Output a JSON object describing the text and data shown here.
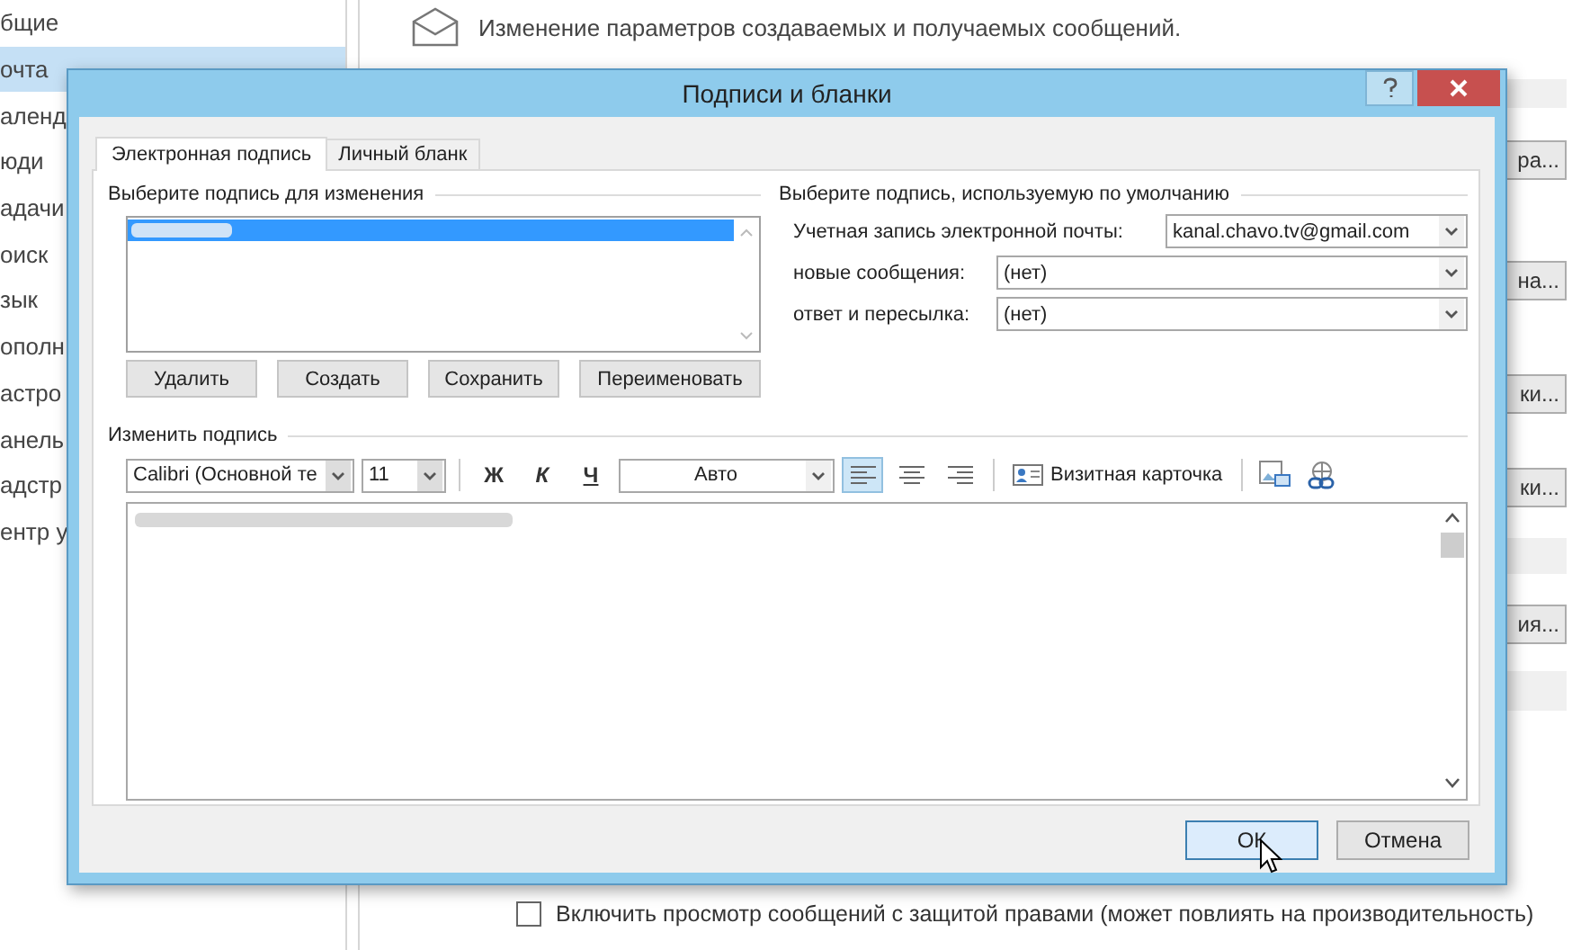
{
  "sidebar": {
    "items": [
      {
        "label": "бщие",
        "selected": false
      },
      {
        "label": "очта",
        "selected": true
      },
      {
        "label": "аленд",
        "selected": false
      },
      {
        "label": "юди",
        "selected": false
      },
      {
        "label": "адачи",
        "selected": false
      },
      {
        "label": "оиск",
        "selected": false
      },
      {
        "label": "зык",
        "selected": false
      },
      {
        "label": "ополн",
        "selected": false
      },
      {
        "label": "астро",
        "selected": false
      },
      {
        "label": "анель",
        "selected": false
      },
      {
        "label": "адстр",
        "selected": false
      },
      {
        "label": "ентр у",
        "selected": false
      }
    ]
  },
  "content": {
    "header": "Изменение параметров создаваемых и получаемых сообщений.",
    "side_items": [
      {
        "kind": "band"
      },
      {
        "kind": "button",
        "label": "ра..."
      },
      {
        "kind": "button",
        "label": "на..."
      },
      {
        "kind": "button",
        "label": "ки..."
      },
      {
        "kind": "button",
        "label": "ки..."
      },
      {
        "kind": "band"
      },
      {
        "kind": "button",
        "label": "ия..."
      },
      {
        "kind": "band"
      }
    ],
    "option": {
      "label": "Включить просмотр сообщений с защитой правами (может повлиять на производительность)",
      "checked": false
    }
  },
  "dialog": {
    "title": "Подписи и бланки",
    "tabs": [
      {
        "label": "Электронная подпись",
        "selected": true
      },
      {
        "label": "Личный бланк",
        "selected": false
      }
    ],
    "select_group": {
      "title": "Выберите подпись для изменения",
      "signatures": [
        {
          "kind": "redacted",
          "selected": true
        }
      ],
      "buttons": [
        "Удалить",
        "Создать",
        "Сохранить",
        "Переименовать"
      ]
    },
    "default_group": {
      "title": "Выберите подпись, используемую по умолчанию",
      "fields": [
        {
          "label": "Учетная запись электронной почты:",
          "value": "kanal.chavo.tv@gmail.com",
          "kind": "short"
        },
        {
          "label": "новые сообщения:",
          "value": "(нет)",
          "kind": "wide"
        },
        {
          "label": "ответ и пересылка:",
          "value": "(нет)",
          "kind": "wide"
        }
      ]
    },
    "edit_group": {
      "title": "Изменить подпись",
      "font": "Calibri (Основной те",
      "size": "11",
      "format": [
        {
          "label": "Ж",
          "kind": "bold"
        },
        {
          "label": "К",
          "kind": "italic"
        },
        {
          "label": "Ч",
          "kind": "underline"
        }
      ],
      "color_label": "Авто",
      "align": [
        {
          "kind": "left",
          "selected": true
        },
        {
          "kind": "center",
          "selected": false
        },
        {
          "kind": "right",
          "selected": false
        }
      ],
      "card_button": "Визитная карточка",
      "body": {
        "kind": "redacted"
      }
    },
    "buttons": [
      {
        "label": "ОК",
        "focused": true
      },
      {
        "label": "Отмена",
        "focused": false
      }
    ]
  }
}
